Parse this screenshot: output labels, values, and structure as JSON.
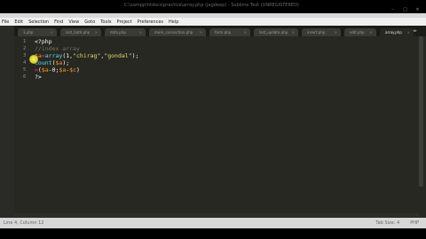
{
  "window": {
    "title": "C:\\xampp\\htdocs\\practice\\array.php (jagdeep) - Sublime Text (UNREGISTERED)",
    "controls": [
      "–",
      "□",
      "✕"
    ]
  },
  "menu": [
    "File",
    "Edit",
    "Selection",
    "Find",
    "View",
    "Goto",
    "Tools",
    "Project",
    "Preferences",
    "Help"
  ],
  "tabs": [
    {
      "label": "1.php"
    },
    {
      "label": "last_bath.php"
    },
    {
      "label": "data.php"
    },
    {
      "label": "more_connection.php"
    },
    {
      "label": "form.php"
    },
    {
      "label": "last_update.php"
    },
    {
      "label": "insert.php"
    },
    {
      "label": "edit.php"
    },
    {
      "label": "array.php",
      "active": true
    }
  ],
  "editor": {
    "line_numbers": [
      "1",
      "2",
      "3",
      "4",
      "5",
      "6"
    ],
    "lines": [
      {
        "parts": [
          [
            "pl",
            "<?php"
          ]
        ]
      },
      {
        "parts": [
          [
            "cm",
            "//index array"
          ]
        ]
      },
      {
        "parts": [
          [
            "var",
            "$a"
          ],
          [
            "pk",
            "="
          ],
          [
            "fn",
            "array"
          ],
          [
            "pl",
            "(1,"
          ],
          [
            "str",
            "\"chirag\""
          ],
          [
            "pl",
            ","
          ],
          [
            "str",
            "\"gondal\""
          ],
          [
            "pl",
            ");"
          ]
        ]
      },
      {
        "parts": [
          [
            "fn",
            "count"
          ],
          [
            "pl",
            "("
          ],
          [
            "var",
            "$a"
          ],
          [
            "pl",
            ");"
          ]
        ]
      },
      {
        "parts": [
          [
            "pk",
            "="
          ],
          [
            "pl",
            "("
          ],
          [
            "var",
            "$a"
          ],
          [
            "pl",
            "-0;"
          ],
          [
            "var",
            "$a"
          ],
          [
            "pl",
            "-"
          ],
          [
            "var",
            "$c"
          ],
          [
            "pl",
            ")"
          ]
        ]
      },
      {
        "parts": [
          [
            "pl",
            "?>"
          ]
        ]
      }
    ]
  },
  "status": {
    "left": "Line 4, Column 12",
    "right": [
      "Tab Size: 4",
      "PHP"
    ]
  }
}
